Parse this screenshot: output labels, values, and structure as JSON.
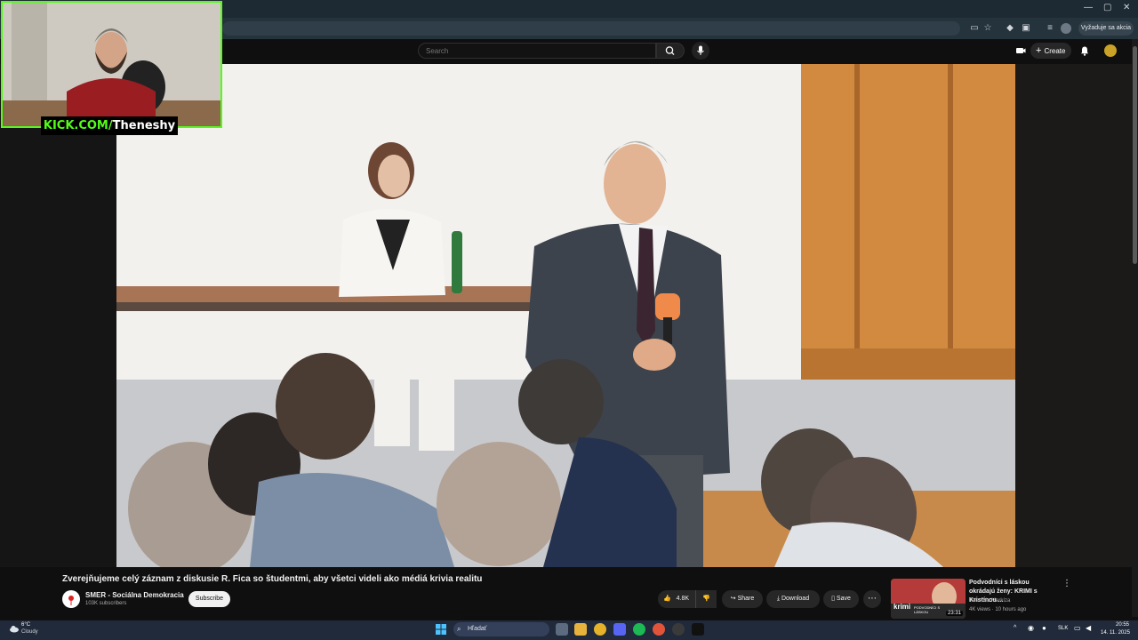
{
  "browser": {
    "profile_label": "Vyžaduje sa akcia",
    "window_controls": [
      "—",
      "▢",
      "✕"
    ]
  },
  "youtube": {
    "search_placeholder": "Search",
    "create_label": "Create",
    "video": {
      "title": "Zverejňujeme celý záznam z diskusie R. Fica so študentmi, aby všetci videli ako médiá krivia realitu",
      "channel_name": "SMER - Sociálna Demokracia",
      "subscribers": "103K subscribers",
      "subscribe_label": "Subscribe",
      "likes": "4.8K",
      "share_label": "Share",
      "download_label": "Download",
      "save_label": "Save"
    },
    "recommendation": {
      "title": "Podvodníci s láskou okrádajú ženy: KRIMI s Kristínou ...",
      "channel": "Televízia Markíza",
      "meta": "4K views · 10 hours ago",
      "duration": "23:31",
      "thumb_caption": "krimi",
      "thumb_badge": "PODVODNÍCI S LÁSKOU"
    }
  },
  "overlay": {
    "kick_prefix": "KICK.COM/",
    "kick_name": "Theneshy"
  },
  "taskbar": {
    "weather_temp": "6°C",
    "weather_desc": "Cloudy",
    "search_placeholder": "Hľadať",
    "language": "SLK",
    "time": "20:55",
    "date": "14. 11. 2025"
  },
  "colors": {
    "kick_green": "#53fc18",
    "youtube_bg": "#0f0f0f",
    "taskbar": "#202a3a"
  }
}
